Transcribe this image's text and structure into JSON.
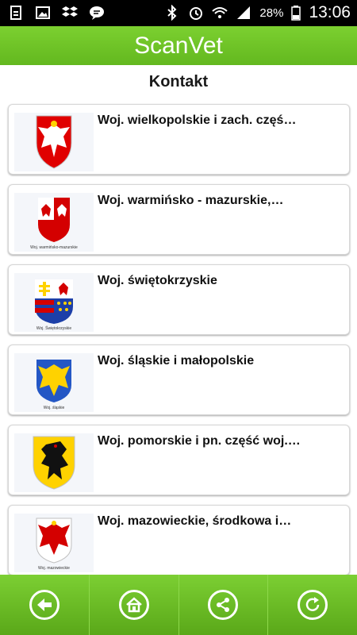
{
  "status_bar": {
    "battery": "28%",
    "time": "13:06",
    "left_icons": [
      "sim-icon",
      "gallery-icon",
      "dropbox-icon",
      "chat-icon"
    ],
    "right_icons": [
      "bluetooth-icon",
      "alarm-icon",
      "wifi-icon",
      "signal-icon",
      "battery-icon"
    ]
  },
  "app_bar": {
    "title": "ScanVet",
    "color": "#6cc226"
  },
  "page": {
    "heading": "Kontakt"
  },
  "regions": [
    {
      "label": "Woj. wielkopolskie i zach. częś…",
      "emblem": "eagle-emblem"
    },
    {
      "label": "Woj. warmińsko - mazurskie,…",
      "emblem": "eagle-emblem",
      "emblem_caption": "Woj. warmińsko-mazurskie"
    },
    {
      "label": "Woj. świętokrzyskie",
      "emblem": "cross-eagle-emblem",
      "emblem_caption": "Woj. Świętokrzyskie"
    },
    {
      "label": "Woj. śląskie i małopolskie",
      "emblem": "golden-eagle-emblem",
      "emblem_caption": "Woj. śląskie"
    },
    {
      "label": "Woj. pomorskie i pn. część woj.…",
      "emblem": "griffin-emblem"
    },
    {
      "label": "Woj. mazowieckie, środkowa i…",
      "emblem": "red-eagle-emblem",
      "emblem_caption": "Woj. mazowieckie"
    }
  ],
  "bottom_nav": [
    {
      "name": "back",
      "icon": "back-arrow-icon"
    },
    {
      "name": "home",
      "icon": "home-icon"
    },
    {
      "name": "share",
      "icon": "share-icon"
    },
    {
      "name": "refresh",
      "icon": "refresh-icon"
    }
  ]
}
